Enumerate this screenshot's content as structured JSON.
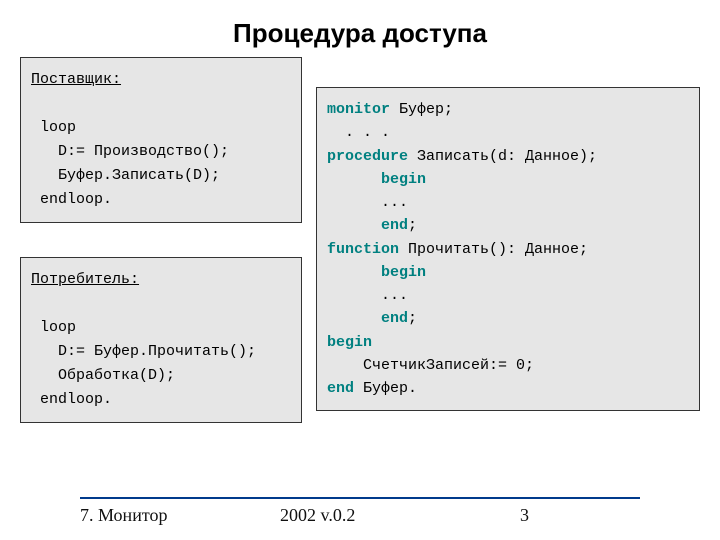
{
  "title": "Процедура доступа",
  "supplier": {
    "heading": "Поставщик:",
    "l1": " loop",
    "l2": "   D:= Производство();",
    "l3": "   Буфер.Записать(D);",
    "l4": " endloop."
  },
  "consumer": {
    "heading": "Потребитель:",
    "l1": " loop",
    "l2": "   D:= Буфер.Прочитать();",
    "l3": "   Обработка(D);",
    "l4": " endloop."
  },
  "monitor": {
    "kw_monitor": "monitor",
    "m1_rest": " Буфер;",
    "m2": "  . . .",
    "kw_procedure": "procedure",
    "m3_rest": " Записать(d: Данное);",
    "kw_begin1": "begin",
    "m5": "      ...",
    "kw_end1": "end",
    "semicolon": ";",
    "kw_function": "function",
    "m7_rest": " Прочитать(): Данное;",
    "kw_begin2": "begin",
    "m9": "      ...",
    "kw_end2": "end",
    "kw_begin3": "begin",
    "m12": "    СчетчикЗаписей:= 0;",
    "kw_end3": "end",
    "m13_rest": " Буфер."
  },
  "footer": {
    "left": "7. Монитор",
    "mid": "2002 v.0.2",
    "right": "3"
  }
}
